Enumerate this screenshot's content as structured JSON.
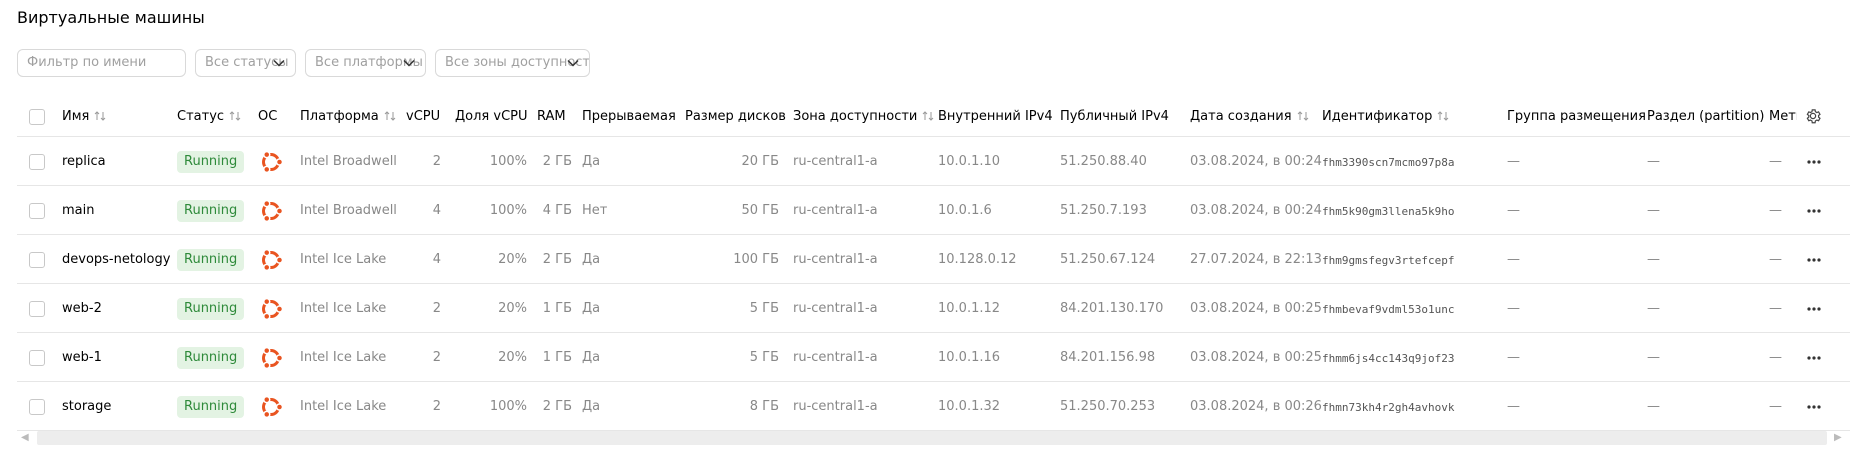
{
  "page": {
    "title": "Виртуальные машины"
  },
  "filters": {
    "name_placeholder": "Фильтр по имени",
    "status": "Все статусы",
    "platform": "Все платформы",
    "zone": "Все зоны доступности"
  },
  "table": {
    "headers": {
      "name": "Имя",
      "status": "Статус",
      "os": "ОС",
      "platform": "Платформа",
      "vcpu": "vCPU",
      "cpu_share": "Доля vCPU",
      "ram": "RAM",
      "preemptible": "Прерываемая",
      "disk_size": "Размер дисков",
      "zone": "Зона доступности",
      "internal_ip": "Внутренний IPv4",
      "public_ip": "Публичный IPv4",
      "created": "Дата создания",
      "id": "Идентификатор",
      "placement_group": "Группа размещения",
      "partition": "Раздел (partition)",
      "labels": "Метки"
    },
    "rows": [
      {
        "name": "replica",
        "status": "Running",
        "platform": "Intel Broadwell",
        "vcpu": "2",
        "cpu_share": "100%",
        "ram": "2 ГБ",
        "preemptible": "Да",
        "disk_size": "20 ГБ",
        "zone": "ru-central1-a",
        "internal_ip": "10.0.1.10",
        "public_ip": "51.250.88.40",
        "created": "03.08.2024, в 00:24",
        "id": "fhm3390scn7mcmo97p8a",
        "placement_group": "—",
        "partition": "—",
        "labels": "—"
      },
      {
        "name": "main",
        "status": "Running",
        "platform": "Intel Broadwell",
        "vcpu": "4",
        "cpu_share": "100%",
        "ram": "4 ГБ",
        "preemptible": "Нет",
        "disk_size": "50 ГБ",
        "zone": "ru-central1-a",
        "internal_ip": "10.0.1.6",
        "public_ip": "51.250.7.193",
        "created": "03.08.2024, в 00:24",
        "id": "fhm5k90gm3llena5k9ho",
        "placement_group": "—",
        "partition": "—",
        "labels": "—"
      },
      {
        "name": "devops-netology",
        "status": "Running",
        "platform": "Intel Ice Lake",
        "vcpu": "4",
        "cpu_share": "20%",
        "ram": "2 ГБ",
        "preemptible": "Да",
        "disk_size": "100 ГБ",
        "zone": "ru-central1-a",
        "internal_ip": "10.128.0.12",
        "public_ip": "51.250.67.124",
        "created": "27.07.2024, в 22:13",
        "id": "fhm9gmsfegv3rtefcepf",
        "placement_group": "—",
        "partition": "—",
        "labels": "—"
      },
      {
        "name": "web-2",
        "status": "Running",
        "platform": "Intel Ice Lake",
        "vcpu": "2",
        "cpu_share": "20%",
        "ram": "1 ГБ",
        "preemptible": "Да",
        "disk_size": "5 ГБ",
        "zone": "ru-central1-a",
        "internal_ip": "10.0.1.12",
        "public_ip": "84.201.130.170",
        "created": "03.08.2024, в 00:25",
        "id": "fhmbevaf9vdml53o1unc",
        "placement_group": "—",
        "partition": "—",
        "labels": "—"
      },
      {
        "name": "web-1",
        "status": "Running",
        "platform": "Intel Ice Lake",
        "vcpu": "2",
        "cpu_share": "20%",
        "ram": "1 ГБ",
        "preemptible": "Да",
        "disk_size": "5 ГБ",
        "zone": "ru-central1-a",
        "internal_ip": "10.0.1.16",
        "public_ip": "84.201.156.98",
        "created": "03.08.2024, в 00:25",
        "id": "fhmm6js4cc143q9jof23",
        "placement_group": "—",
        "partition": "—",
        "labels": "—"
      },
      {
        "name": "storage",
        "status": "Running",
        "platform": "Intel Ice Lake",
        "vcpu": "2",
        "cpu_share": "100%",
        "ram": "2 ГБ",
        "preemptible": "Да",
        "disk_size": "8 ГБ",
        "zone": "ru-central1-a",
        "internal_ip": "10.0.1.32",
        "public_ip": "51.250.70.253",
        "created": "03.08.2024, в 00:26",
        "id": "fhmn73kh4r2gh4avhovk",
        "placement_group": "—",
        "partition": "—",
        "labels": "—"
      }
    ]
  },
  "icons": {
    "os": "ubuntu-icon",
    "row_menu": "more-horizontal-icon",
    "settings": "gear-icon",
    "sort": "sort-arrows-icon"
  },
  "colors": {
    "status_bg": "#e3f3e3",
    "status_text": "#2e8a3a",
    "ubuntu": "#e95420"
  }
}
